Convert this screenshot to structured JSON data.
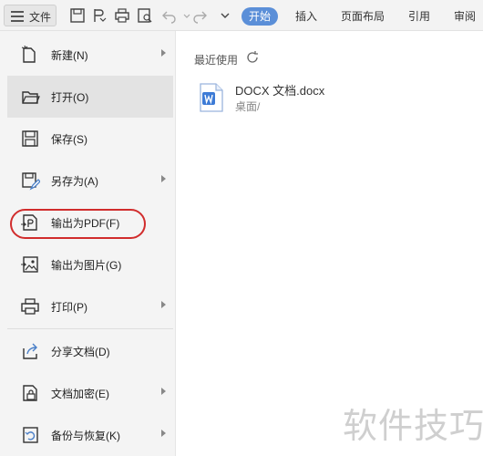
{
  "toolbar": {
    "file_label": "文件",
    "tabs": [
      "开始",
      "插入",
      "页面布局",
      "引用",
      "审阅"
    ],
    "active_tab": "开始",
    "accent": "#5b8fd8"
  },
  "menu": {
    "items": [
      {
        "label": "新建(N)",
        "icon": "new-doc-icon",
        "submenu": true
      },
      {
        "label": "打开(O)",
        "icon": "folder-open-icon",
        "submenu": false
      },
      {
        "label": "保存(S)",
        "icon": "save-icon",
        "submenu": false
      },
      {
        "label": "另存为(A)",
        "icon": "save-as-icon",
        "submenu": true
      },
      {
        "label": "输出为PDF(F)",
        "icon": "export-pdf-icon",
        "submenu": false
      },
      {
        "label": "输出为图片(G)",
        "icon": "export-image-icon",
        "submenu": false
      },
      {
        "label": "打印(P)",
        "icon": "print-icon",
        "submenu": true
      },
      {
        "label": "分享文档(D)",
        "icon": "share-icon",
        "submenu": false
      },
      {
        "label": "文档加密(E)",
        "icon": "encrypt-icon",
        "submenu": true
      },
      {
        "label": "备份与恢复(K)",
        "icon": "backup-icon",
        "submenu": true
      }
    ],
    "highlight_color": "#d12c2c"
  },
  "recent": {
    "title": "最近使用",
    "files": [
      {
        "name": "DOCX 文档.docx",
        "path": "桌面/"
      }
    ]
  },
  "watermark": "软件技巧"
}
